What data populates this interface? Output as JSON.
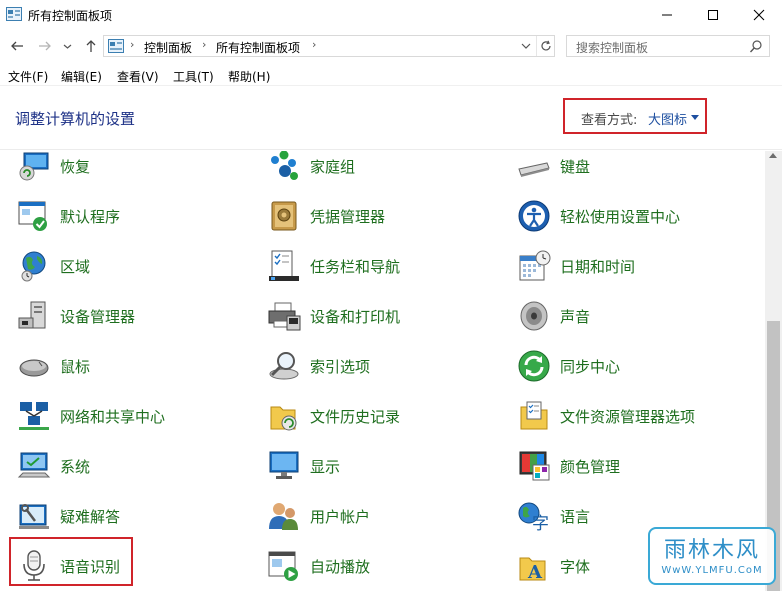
{
  "window": {
    "title": "所有控制面板项"
  },
  "address": {
    "crumbs": [
      "控制面板",
      "所有控制面板项"
    ]
  },
  "search": {
    "placeholder": "搜索控制面板"
  },
  "menu": [
    "文件(F)",
    "编辑(E)",
    "查看(V)",
    "工具(T)",
    "帮助(H)"
  ],
  "header": {
    "title": "调整计算机的设置",
    "view_by_label": "查看方式:",
    "view_by_value": "大图标"
  },
  "items": [
    {
      "label": "恢复",
      "icon": "recovery-icon"
    },
    {
      "label": "家庭组",
      "icon": "homegroup-icon"
    },
    {
      "label": "键盘",
      "icon": "keyboard-icon"
    },
    {
      "label": "默认程序",
      "icon": "default-programs-icon"
    },
    {
      "label": "凭据管理器",
      "icon": "credential-manager-icon"
    },
    {
      "label": "轻松使用设置中心",
      "icon": "ease-of-access-icon"
    },
    {
      "label": "区域",
      "icon": "region-icon"
    },
    {
      "label": "任务栏和导航",
      "icon": "taskbar-icon"
    },
    {
      "label": "日期和时间",
      "icon": "calendar-icon"
    },
    {
      "label": "设备管理器",
      "icon": "device-manager-icon"
    },
    {
      "label": "设备和打印机",
      "icon": "printer-icon"
    },
    {
      "label": "声音",
      "icon": "speaker-icon"
    },
    {
      "label": "鼠标",
      "icon": "mouse-icon"
    },
    {
      "label": "索引选项",
      "icon": "indexing-icon"
    },
    {
      "label": "同步中心",
      "icon": "sync-center-icon"
    },
    {
      "label": "网络和共享中心",
      "icon": "network-icon"
    },
    {
      "label": "文件历史记录",
      "icon": "file-history-icon"
    },
    {
      "label": "文件资源管理器选项",
      "icon": "folder-options-icon"
    },
    {
      "label": "系统",
      "icon": "system-icon"
    },
    {
      "label": "显示",
      "icon": "display-icon"
    },
    {
      "label": "颜色管理",
      "icon": "color-management-icon"
    },
    {
      "label": "疑难解答",
      "icon": "troubleshooting-icon"
    },
    {
      "label": "用户帐户",
      "icon": "user-accounts-icon"
    },
    {
      "label": "语言",
      "icon": "language-icon"
    },
    {
      "label": "语音识别",
      "icon": "microphone-icon"
    },
    {
      "label": "自动播放",
      "icon": "autoplay-icon"
    },
    {
      "label": "字体",
      "icon": "fonts-icon"
    }
  ],
  "watermark": {
    "title": "雨林木风",
    "url": "WwW.YLMFU.CoM"
  },
  "colors": {
    "item_text": "#1e6e1e",
    "title_text": "#1e3287",
    "highlight": "#d0242a",
    "link": "#1e4fa0"
  }
}
